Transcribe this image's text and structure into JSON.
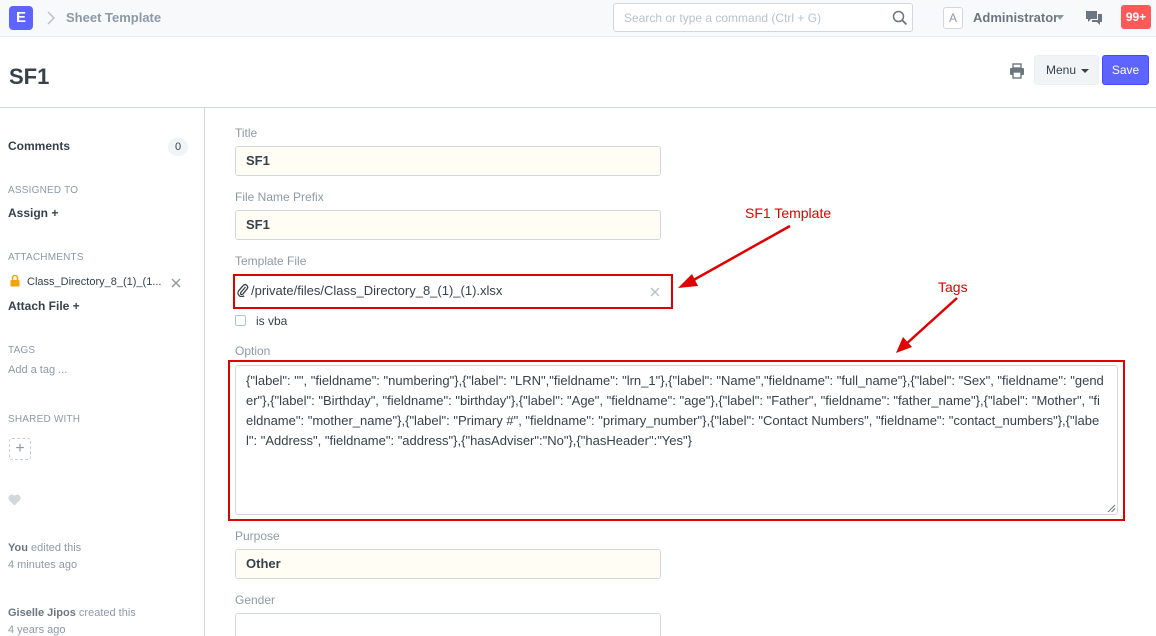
{
  "navbar": {
    "brand_letter": "E",
    "breadcrumb": "Sheet Template",
    "search_placeholder": "Search or type a command (Ctrl + G)",
    "avatar_letter": "A",
    "user_name": "Administrator",
    "notifications": "99+"
  },
  "page": {
    "title": "SF1",
    "menu_label": "Menu",
    "save_label": "Save"
  },
  "sidebar": {
    "comments_label": "Comments",
    "comments_count": "0",
    "assigned_to_label": "ASSIGNED TO",
    "assign_label": "Assign +",
    "attachments_label": "ATTACHMENTS",
    "attachment_name": "Class_Directory_8_(1)_(1...",
    "attach_file_label": "Attach File +",
    "tags_label": "TAGS",
    "add_tag": "Add a tag ...",
    "shared_with_label": "SHARED WITH",
    "share_plus": "+",
    "activity": [
      {
        "actor": "You",
        "action": " edited this",
        "time": "4 minutes ago"
      },
      {
        "actor": "Giselle Jipos",
        "action": " created this",
        "time": "4 years ago"
      }
    ]
  },
  "form": {
    "title_label": "Title",
    "title_value": "SF1",
    "prefix_label": "File Name Prefix",
    "prefix_value": "SF1",
    "template_label": "Template File",
    "template_value": "/private/files/Class_Directory_8_(1)_(1).xlsx",
    "is_vba_label": "is vba",
    "option_label": "Option",
    "option_value": "{\"label\": \"\", \"fieldname\": \"numbering\"},{\"label\": \"LRN\",\"fieldname\": \"lrn_1\"},{\"label\": \"Name\",\"fieldname\": \"full_name\"},{\"label\": \"Sex\", \"fieldname\": \"gender\"},{\"label\": \"Birthday\", \"fieldname\": \"birthday\"},{\"label\": \"Age\", \"fieldname\": \"age\"},{\"label\": \"Father\", \"fieldname\": \"father_name\"},{\"label\": \"Mother\", \"fieldname\": \"mother_name\"},{\"label\": \"Primary #\", \"fieldname\": \"primary_number\"},{\"label\": \"Contact Numbers\", \"fieldname\": \"contact_numbers\"},{\"label\": \"Address\", \"fieldname\": \"address\"},{\"hasAdviser\":\"No\"},{\"hasHeader\":\"Yes\"}",
    "purpose_label": "Purpose",
    "purpose_value": "Other",
    "gender_label": "Gender"
  },
  "annotations": {
    "template_note": "SF1 Template",
    "tags_note": "Tags",
    "color": "#e00000"
  }
}
